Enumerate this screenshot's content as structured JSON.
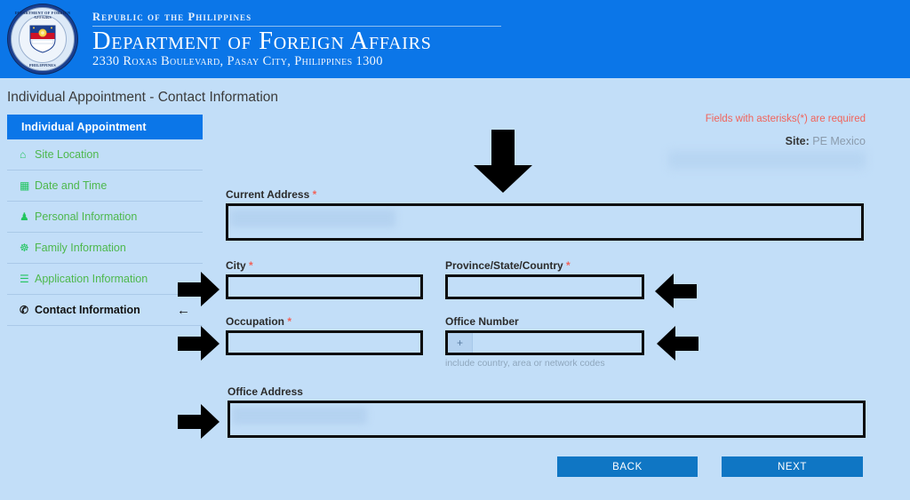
{
  "header": {
    "line1": "Republic of the Philippines",
    "line2": "Department of Foreign Affairs",
    "line3": "2330 Roxas Boulevard, Pasay City, Philippines 1300",
    "seal_text_top": "DEPARTMENT OF FOREIGN AFFAIRS",
    "seal_text_bottom": "PHILIPPINES",
    "brand_color": "#0b76e8"
  },
  "page": {
    "title": "Individual Appointment - Contact Information",
    "background_color": "#c2def8"
  },
  "sidebar": {
    "heading": "Individual Appointment",
    "items": [
      {
        "label": "Site Location",
        "icon": "home-icon",
        "glyph": "⌂",
        "active": false
      },
      {
        "label": "Date and Time",
        "icon": "calendar-icon",
        "glyph": "▦",
        "active": false
      },
      {
        "label": "Personal Information",
        "icon": "user-icon",
        "glyph": "♟",
        "active": false
      },
      {
        "label": "Family Information",
        "icon": "users-icon",
        "glyph": "☸",
        "active": false
      },
      {
        "label": "Application Information",
        "icon": "list-card-icon",
        "glyph": "☰",
        "active": false
      },
      {
        "label": "Contact Information",
        "icon": "phone-icon",
        "glyph": "✆",
        "active": true,
        "marker": "←"
      }
    ],
    "active_color": "#111111",
    "item_color": "#4db84d"
  },
  "notices": {
    "required_note": "Fields with asterisks(*) are required",
    "required_note_color": "#f1635a",
    "site_label": "Site:",
    "site_value": "PE Mexico"
  },
  "form": {
    "fields": [
      {
        "name": "current-address",
        "label": "Current Address",
        "required": true,
        "value": "",
        "redacted": true,
        "hint": ""
      },
      {
        "name": "city",
        "label": "City",
        "required": true,
        "value": "",
        "redacted": false,
        "hint": ""
      },
      {
        "name": "province",
        "label": "Province/State/Country",
        "required": true,
        "value": "",
        "redacted": false,
        "hint": ""
      },
      {
        "name": "occupation",
        "label": "Occupation",
        "required": true,
        "value": "",
        "redacted": false,
        "hint": ""
      },
      {
        "name": "office-number",
        "label": "Office Number",
        "required": false,
        "value": "",
        "redacted": false,
        "prefix": "+",
        "hint": "include country, area or network codes"
      },
      {
        "name": "office-address",
        "label": "Office Address",
        "required": false,
        "value": "",
        "redacted": true,
        "hint": ""
      }
    ],
    "asterisk": "*"
  },
  "buttons": {
    "back": "BACK",
    "next": "NEXT",
    "color": "#0f76c4"
  }
}
